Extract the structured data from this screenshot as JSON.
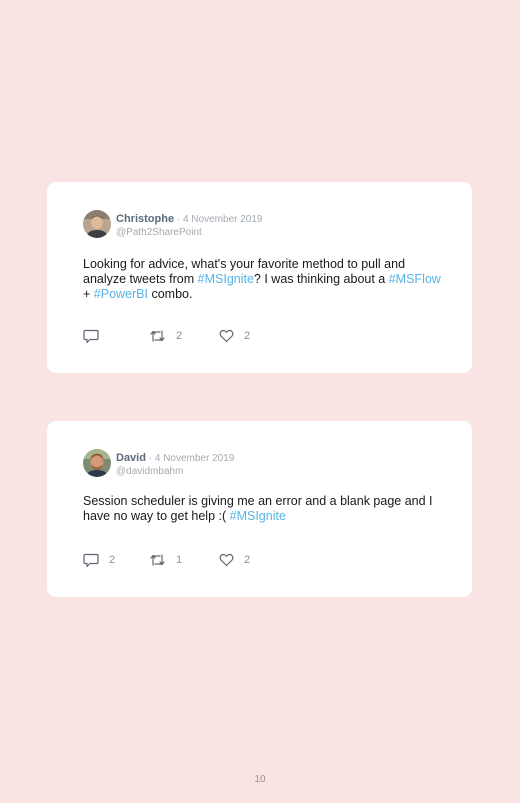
{
  "tweets": [
    {
      "name": "Christophe",
      "separator": " · ",
      "date": "4 November 2019",
      "handle": "@Path2SharePoint",
      "text_parts": [
        {
          "text": "Looking for advice, what's your favorite method to pull and analyze tweets from ",
          "tag": false
        },
        {
          "text": "#MSIgnite",
          "tag": true
        },
        {
          "text": "? I was thinking about a ",
          "tag": false
        },
        {
          "text": "#MSFlow",
          "tag": true
        },
        {
          "text": " + ",
          "tag": false
        },
        {
          "text": "#PowerBI",
          "tag": true
        },
        {
          "text": " combo.",
          "tag": false
        }
      ],
      "replies": "",
      "retweets": "2",
      "likes": "2"
    },
    {
      "name": "David",
      "separator": " · ",
      "date": "4 November 2019",
      "handle": "@davidmbahm",
      "text_parts": [
        {
          "text": "Session scheduler is giving me an error and a blank page and I have no way to get help :( ",
          "tag": false
        },
        {
          "text": "#MSIgnite",
          "tag": true
        }
      ],
      "replies": "2",
      "retweets": "1",
      "likes": "2"
    }
  ],
  "icons": {
    "reply": "reply-icon",
    "retweet": "retweet-icon",
    "like": "heart-icon"
  },
  "colors": {
    "background": "#f9e3e3",
    "card": "#ffffff",
    "hashtag": "#56b4e6",
    "name": "#5b6b7c",
    "meta": "#a3aab2"
  },
  "page_number": "10"
}
